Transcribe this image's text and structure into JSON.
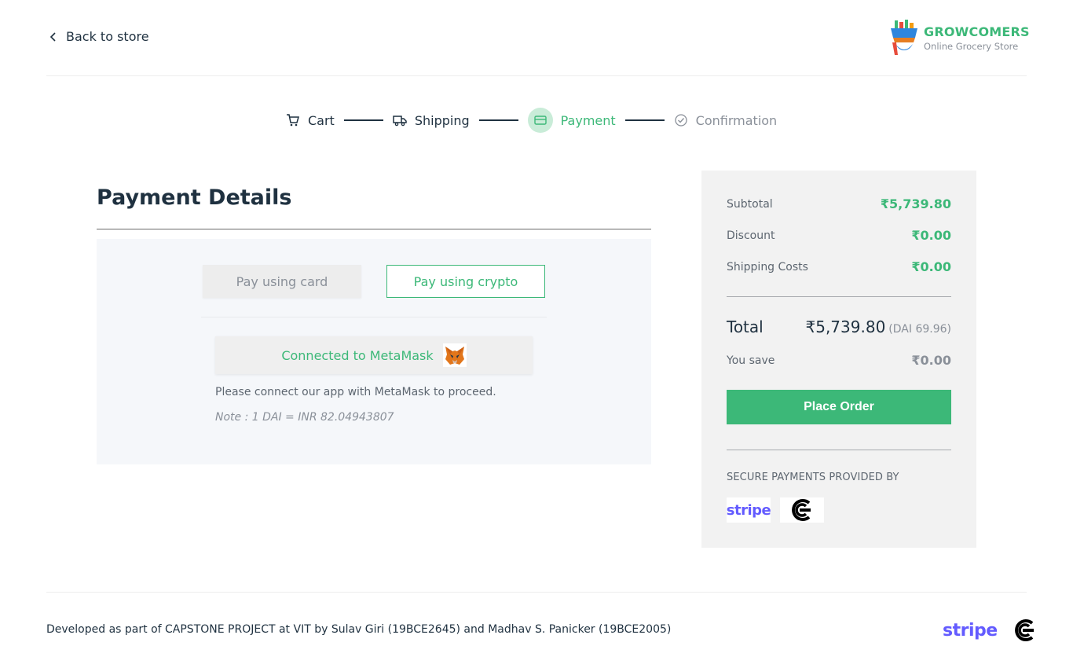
{
  "header": {
    "back_label": "Back to store",
    "brand_name": "GROWCOMERS",
    "brand_tagline": "Online Grocery Store"
  },
  "stepper": {
    "steps": [
      {
        "label": "Cart",
        "icon": "cart-icon",
        "state": "done"
      },
      {
        "label": "Shipping",
        "icon": "truck-icon",
        "state": "done"
      },
      {
        "label": "Payment",
        "icon": "credit-card-icon",
        "state": "active"
      },
      {
        "label": "Confirmation",
        "icon": "check-circle-icon",
        "state": "pending"
      }
    ]
  },
  "payment": {
    "title": "Payment Details",
    "tabs": {
      "card_label": "Pay using card",
      "crypto_label": "Pay using crypto",
      "selected": "crypto"
    },
    "metamask_label": "Connected to MetaMask",
    "connect_message": "Please connect our app with MetaMask to proceed.",
    "note": "Note : 1 DAI = INR 82.04943807"
  },
  "summary": {
    "subtotal_label": "Subtotal",
    "subtotal_value": "₹5,739.80",
    "discount_label": "Discount",
    "discount_value": "₹0.00",
    "shipping_label": "Shipping Costs",
    "shipping_value": "₹0.00",
    "total_label": "Total",
    "total_value": "₹5,739.80",
    "total_dai": "(DAI 69.96)",
    "save_label": "You save",
    "save_value": "₹0.00",
    "place_order_label": "Place Order",
    "secure_label": "SECURE PAYMENTS PROVIDED BY",
    "stripe_label": "stripe"
  },
  "footer": {
    "text": "Developed as part of CAPSTONE PROJECT at VIT by Sulav Giri (19BCE2645) and Madhav S. Panicker (19BCE2005)",
    "stripe_label": "stripe"
  },
  "colors": {
    "accent": "#3cb878",
    "text_dark": "#1f3140",
    "muted": "#8a9099",
    "stripe": "#635bff"
  }
}
